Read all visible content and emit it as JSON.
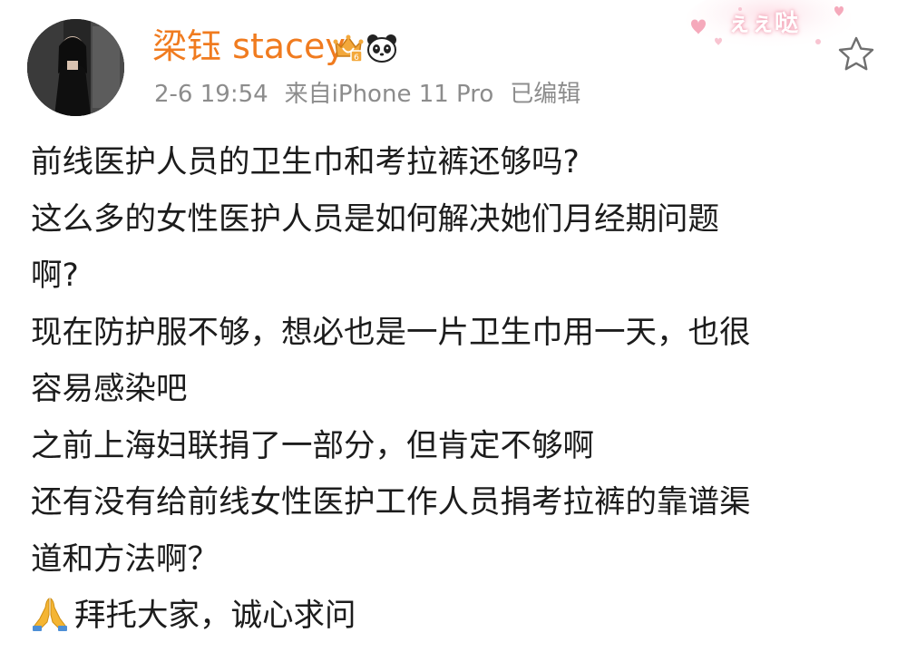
{
  "post": {
    "author": {
      "name": "梁钰 stacey",
      "avatar_icon": "avatar-photo",
      "badges": [
        "vip-crown-icon",
        "panda-icon"
      ]
    },
    "meta": {
      "date": "2-6 19:54",
      "source": "来自iPhone 11 Pro",
      "edited": "已编辑"
    },
    "card_decoration": "ぇぇ哒",
    "actions": {
      "favorite_icon": "star-icon"
    },
    "body_lines": [
      "前线医护人员的卫生巾和考拉裤还够吗?",
      "这么多的女性医护人员是如何解决她们月经期问题",
      "啊?",
      "现在防护服不够，想必也是一片卫生巾用一天，也很",
      "容易感染吧",
      "之前上海妇联捐了一部分，但肯定不够啊",
      "还有没有给前线女性医护工作人员捐考拉裤的靠谱渠",
      "道和方法啊？",
      "拜托大家，诚心求问"
    ],
    "last_line_icon": "praying-hands-icon"
  },
  "colors": {
    "username": "#f07b1f",
    "meta": "#8c8c8c",
    "body_text": "#1c1c1c",
    "decoration_pink": "#f7b7c7"
  }
}
